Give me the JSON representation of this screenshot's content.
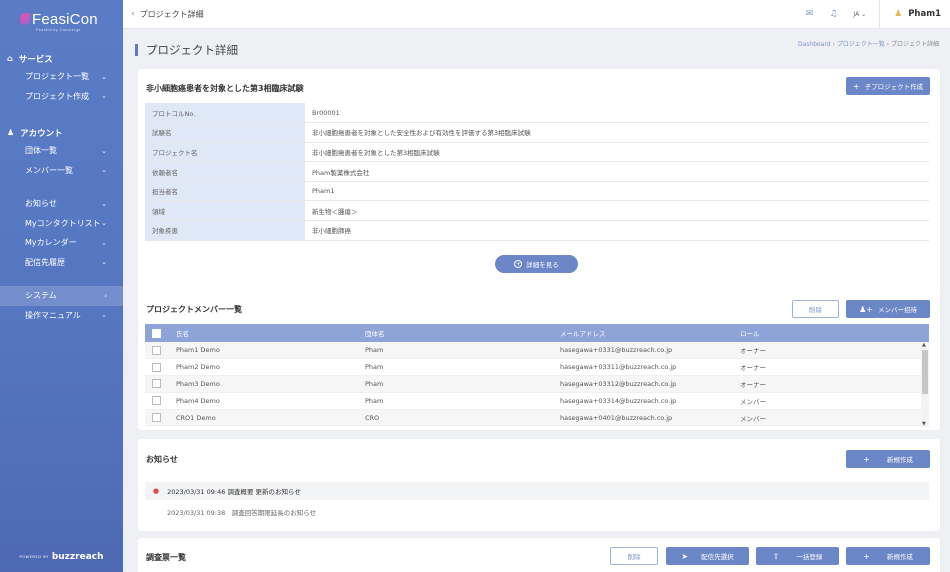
{
  "brand": {
    "name": "FeasiCon",
    "tagline": "Feasibility Concierge"
  },
  "sidebar": {
    "service": {
      "title": "サービス",
      "items": [
        "プロジェクト一覧",
        "プロジェクト作成"
      ]
    },
    "account": {
      "title": "アカウント",
      "items": [
        "団体一覧",
        "メンバー一覧"
      ]
    },
    "misc": [
      "お知らせ",
      "Myコンタクトリスト",
      "Myカレンダー",
      "配信先履歴"
    ],
    "system": "システム",
    "manual": "操作マニュアル",
    "footer": {
      "powered": "POWERED BY",
      "company": "buzzreach"
    }
  },
  "topbar": {
    "title": "プロジェクト詳細",
    "lang": "JA",
    "user": "Pham1"
  },
  "page": {
    "title": "プロジェクト詳細",
    "breadcrumb": {
      "home": "Dashboard",
      "list": "プロジェクト一覧",
      "current": "プロジェクト詳細"
    }
  },
  "project": {
    "title": "非小細胞癌患者を対象とした第3相臨床試験",
    "create_button": "子プロジェクト作成",
    "fields": [
      {
        "label": "プロトコルNo.",
        "value": "Br00001"
      },
      {
        "label": "試験名",
        "value": "非小細胞癌患者を対象とした安全性および有効性を評価する第3相臨床試験"
      },
      {
        "label": "プロジェクト名",
        "value": "非小細胞癌患者を対象とした第3相臨床試験"
      },
      {
        "label": "依頼者名",
        "value": "Pham製薬株式会社"
      },
      {
        "label": "担当者名",
        "value": "Pham1"
      },
      {
        "label": "領域",
        "value": "新生物＜腫瘍＞"
      },
      {
        "label": "対象疾患",
        "value": "非小細胞肺癌"
      }
    ],
    "detail_button": "詳細を見る"
  },
  "members": {
    "title": "プロジェクトメンバー一覧",
    "delete_button": "削除",
    "invite_button": "メンバー招待",
    "columns": [
      "氏名",
      "団体名",
      "メールアドレス",
      "ロール"
    ],
    "rows": [
      {
        "name": "Pham1 Demo",
        "org": "Pham",
        "email": "hasegawa+0331@buzzreach.co.jp",
        "role": "オーナー"
      },
      {
        "name": "Pham2 Demo",
        "org": "Pham",
        "email": "hasegawa+03311@buzzreach.co.jp",
        "role": "オーナー"
      },
      {
        "name": "Pham3 Demo",
        "org": "Pham",
        "email": "hasegawa+03312@buzzreach.co.jp",
        "role": "オーナー"
      },
      {
        "name": "Pham4 Demo",
        "org": "Pham",
        "email": "hasegawa+03314@buzzreach.co.jp",
        "role": "メンバー"
      },
      {
        "name": "CRO1 Demo",
        "org": "CRO",
        "email": "hasegawa+0401@buzzreach.co.jp",
        "role": "メンバー"
      }
    ]
  },
  "notices": {
    "title": "お知らせ",
    "new_button": "新規作成",
    "items": [
      {
        "text": "2023/03/31 09:46 調査概要 更新のお知らせ"
      },
      {
        "text": "2023/03/31 09:38　調査回答期限延長のお知らせ"
      }
    ]
  },
  "surveys": {
    "title": "調査票一覧",
    "delete_button": "削除",
    "select_button": "配信先選択",
    "bulk_button": "一括登録",
    "new_button": "新規作成"
  }
}
